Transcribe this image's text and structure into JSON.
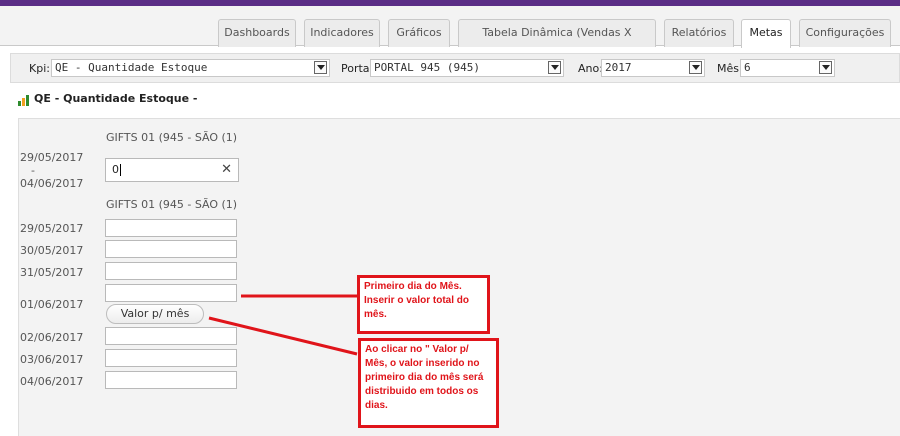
{
  "tabs": [
    {
      "label": "Dashboards"
    },
    {
      "label": "Indicadores"
    },
    {
      "label": "Gráficos"
    },
    {
      "label": "Tabela Dinâmica (Vendas X Estoque)"
    },
    {
      "label": "Relatórios"
    },
    {
      "label": "Metas",
      "active": true
    },
    {
      "label": "Configurações"
    }
  ],
  "filters": {
    "kpi_label": "Kpi:",
    "kpi_value": "QE - Quantidade Estoque",
    "portal_label": "Portal:",
    "portal_value": "PORTAL 945 (945)",
    "ano_label": "Ano:",
    "ano_value": "2017",
    "mes_label": "Mês:",
    "mes_value": "6"
  },
  "section": {
    "title": "QE - Quantidade Estoque -"
  },
  "weekly": {
    "store": "GIFTS 01 (945 - SÃO (1)",
    "date_start": "29/05/2017",
    "date_sep": "-",
    "date_end": "04/06/2017",
    "input_value": "0",
    "clear_symbol": "✕"
  },
  "daily": {
    "store": "GIFTS 01 (945 - SÃO (1)",
    "dates": [
      "29/05/2017",
      "30/05/2017",
      "31/05/2017",
      "01/06/2017",
      "02/06/2017",
      "03/06/2017",
      "04/06/2017"
    ],
    "button_label": "Valor p/ mês"
  },
  "callouts": {
    "first": "Primeiro dia do Mês. Inserir o valor total do mês.",
    "second": "Ao clicar no \" Valor p/ Mês, o valor inserido no primeiro dia do mês será distribuido em todos os dias."
  },
  "colors": {
    "brand": "#5b2d86",
    "callout": "#e0141a"
  }
}
